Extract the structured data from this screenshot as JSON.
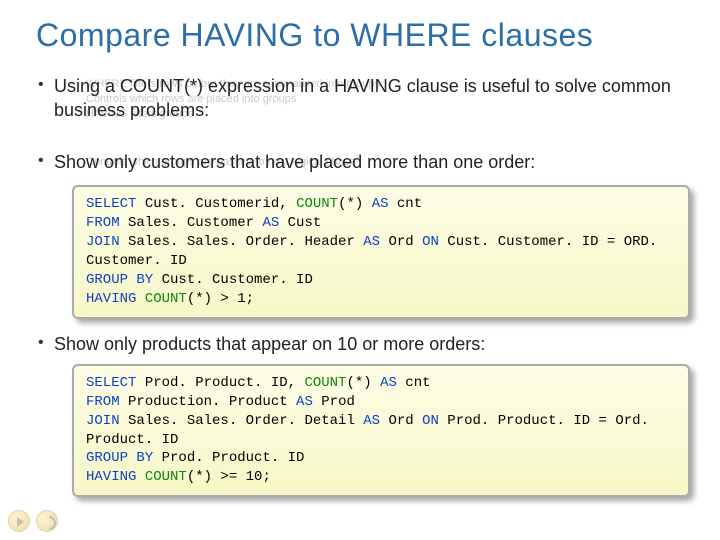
{
  "title": "Compare HAVING to WHERE clauses",
  "bullet1_main": "Using a COUNT(*) expression in a HAVING clause is useful to solve common business problems:",
  "bullet1_ghost": {
    "l1": "WHERE filters rows before they are summarized into groups",
    "l2": "Controls which rows are placed into groups",
    "l3": "HAVING filters groups",
    "l4": "Controls which groups are passed to next logical phase"
  },
  "bullet2_main": "Show only customers that have placed more than one order:",
  "bullet3_main": "Show only products that appear on 10 or more orders:",
  "code1": {
    "s1a": "SELECT",
    "s1b": " Cust. Customerid, ",
    "s1c": "COUNT",
    "s1d": "(*) ",
    "s1e": "AS",
    "s1f": " cnt",
    "s2a": "FROM",
    "s2b": " Sales. Customer ",
    "s2c": "AS",
    "s2d": " Cust",
    "s3a": "JOIN",
    "s3b": " Sales. Sales. Order. Header ",
    "s3c": "AS",
    "s3d": " Ord ",
    "s3e": "ON",
    "s3f": " Cust. Customer. ID = ORD. Customer. ID",
    "s4a": "GROUP BY",
    "s4b": " Cust. Customer. ID",
    "s5a": "HAVING ",
    "s5b": "COUNT",
    "s5c": "(*) > 1;"
  },
  "code2": {
    "s1a": "SELECT",
    "s1b": " Prod. Product. ID, ",
    "s1c": "COUNT",
    "s1d": "(*) ",
    "s1e": "AS",
    "s1f": " cnt",
    "s2a": "FROM",
    "s2b": " Production. Product ",
    "s2c": "AS",
    "s2d": " Prod",
    "s3a": "JOIN",
    "s3b": " Sales. Sales. Order. Detail ",
    "s3c": "AS",
    "s3d": " Ord ",
    "s3e": "ON",
    "s3f": " Prod. Product. ID = Ord. Product. ID",
    "s4a": "GROUP BY",
    "s4b": " Prod. Product. ID",
    "s5a": "HAVING ",
    "s5b": "COUNT",
    "s5c": "(*) >= 10;"
  },
  "chart_data": null
}
